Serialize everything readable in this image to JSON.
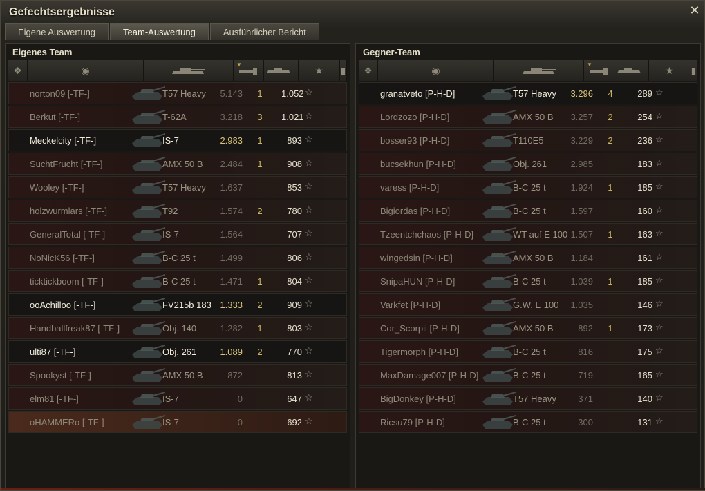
{
  "window": {
    "title": "Gefechtsergebnisse"
  },
  "tabs": [
    {
      "label": "Eigene Auswertung",
      "active": false
    },
    {
      "label": "Team-Auswertung",
      "active": true
    },
    {
      "label": "Ausführlicher Bericht",
      "active": false
    }
  ],
  "columns": [
    "platoon-icon",
    "player-icon",
    "tank-icon",
    "xp-icon",
    "kills-icon",
    "score-icon",
    "medal-icon"
  ],
  "own_team": {
    "title": "Eigenes Team",
    "rows": [
      {
        "player": "norton09 [-TF-]",
        "tank": "T57 Heavy",
        "xp": "5.143",
        "kills": "1",
        "score": "1.052",
        "highlight": false
      },
      {
        "player": "Berkut [-TF-]",
        "tank": "T-62A",
        "xp": "3.218",
        "kills": "3",
        "score": "1.021",
        "highlight": false
      },
      {
        "player": "Meckelcity [-TF-]",
        "tank": "IS-7",
        "xp": "2.983",
        "kills": "1",
        "score": "893",
        "highlight": true
      },
      {
        "player": "SuchtFrucht [-TF-]",
        "tank": "AMX 50 B",
        "xp": "2.484",
        "kills": "1",
        "score": "908",
        "highlight": false
      },
      {
        "player": "Wooley [-TF-]",
        "tank": "T57 Heavy",
        "xp": "1.637",
        "kills": "",
        "score": "853",
        "highlight": false
      },
      {
        "player": "holzwurmlars [-TF-]",
        "tank": "T92",
        "xp": "1.574",
        "kills": "2",
        "score": "780",
        "highlight": false
      },
      {
        "player": "GeneralTotal [-TF-]",
        "tank": "IS-7",
        "xp": "1.564",
        "kills": "",
        "score": "707",
        "highlight": false
      },
      {
        "player": "NoNicK56 [-TF-]",
        "tank": "B-C 25 t",
        "xp": "1.499",
        "kills": "",
        "score": "806",
        "highlight": false
      },
      {
        "player": "ticktickboom [-TF-]",
        "tank": "B-C 25 t",
        "xp": "1.471",
        "kills": "1",
        "score": "804",
        "highlight": false
      },
      {
        "player": "ooAchilloo [-TF-]",
        "tank": "FV215b 183",
        "xp": "1.333",
        "kills": "2",
        "score": "909",
        "highlight": true
      },
      {
        "player": "Handballfreak87 [-TF-]",
        "tank": "Obj. 140",
        "xp": "1.282",
        "kills": "1",
        "score": "803",
        "highlight": false
      },
      {
        "player": "ulti87 [-TF-]",
        "tank": "Obj. 261",
        "xp": "1.089",
        "kills": "2",
        "score": "770",
        "highlight": true
      },
      {
        "player": "Spookyst [-TF-]",
        "tank": "AMX 50 B",
        "xp": "872",
        "kills": "",
        "score": "813",
        "highlight": false
      },
      {
        "player": "elm81 [-TF-]",
        "tank": "IS-7",
        "xp": "0",
        "kills": "",
        "score": "647",
        "highlight": false
      },
      {
        "player": "oHAMMERo [-TF-]",
        "tank": "IS-7",
        "xp": "0",
        "kills": "",
        "score": "692",
        "highlight": false,
        "self": true
      }
    ]
  },
  "enemy_team": {
    "title": "Gegner-Team",
    "rows": [
      {
        "player": "granatveto [P-H-D]",
        "tank": "T57 Heavy",
        "xp": "3.296",
        "kills": "4",
        "score": "289",
        "highlight": true
      },
      {
        "player": "Lordzozo [P-H-D]",
        "tank": "AMX 50 B",
        "xp": "3.257",
        "kills": "2",
        "score": "254",
        "highlight": false
      },
      {
        "player": "bosser93 [P-H-D]",
        "tank": "T110E5",
        "xp": "3.229",
        "kills": "2",
        "score": "236",
        "highlight": false
      },
      {
        "player": "bucsekhun [P-H-D]",
        "tank": "Obj. 261",
        "xp": "2.985",
        "kills": "",
        "score": "183",
        "highlight": false
      },
      {
        "player": "varess [P-H-D]",
        "tank": "B-C 25 t",
        "xp": "1.924",
        "kills": "1",
        "score": "185",
        "highlight": false
      },
      {
        "player": "Bigiordas [P-H-D]",
        "tank": "B-C 25 t",
        "xp": "1.597",
        "kills": "",
        "score": "160",
        "highlight": false
      },
      {
        "player": "Tzeentchchaos [P-H-D]",
        "tank": "WT auf E 100",
        "xp": "1.507",
        "kills": "1",
        "score": "163",
        "highlight": false
      },
      {
        "player": "wingedsin [P-H-D]",
        "tank": "AMX 50 B",
        "xp": "1.184",
        "kills": "",
        "score": "161",
        "highlight": false
      },
      {
        "player": "SnipaHUN [P-H-D]",
        "tank": "B-C 25 t",
        "xp": "1.039",
        "kills": "1",
        "score": "185",
        "highlight": false
      },
      {
        "player": "Varkfet [P-H-D]",
        "tank": "G.W. E 100",
        "xp": "1.035",
        "kills": "",
        "score": "146",
        "highlight": false
      },
      {
        "player": "Cor_Scorpii [P-H-D]",
        "tank": "AMX 50 B",
        "xp": "892",
        "kills": "1",
        "score": "173",
        "highlight": false
      },
      {
        "player": "Tigermorph [P-H-D]",
        "tank": "B-C 25 t",
        "xp": "816",
        "kills": "",
        "score": "175",
        "highlight": false
      },
      {
        "player": "MaxDamage007 [P-H-D]",
        "tank": "B-C 25 t",
        "xp": "719",
        "kills": "",
        "score": "165",
        "highlight": false
      },
      {
        "player": "BigDonkey [P-H-D]",
        "tank": "T57 Heavy",
        "xp": "371",
        "kills": "",
        "score": "140",
        "highlight": false
      },
      {
        "player": "Ricsu79 [P-H-D]",
        "tank": "B-C 25 t",
        "xp": "300",
        "kills": "",
        "score": "131",
        "highlight": false
      }
    ]
  },
  "colors": {
    "accent": "#c7a14a",
    "highlight_text": "#f0ebd8",
    "self_row": "#4a2a1c"
  }
}
